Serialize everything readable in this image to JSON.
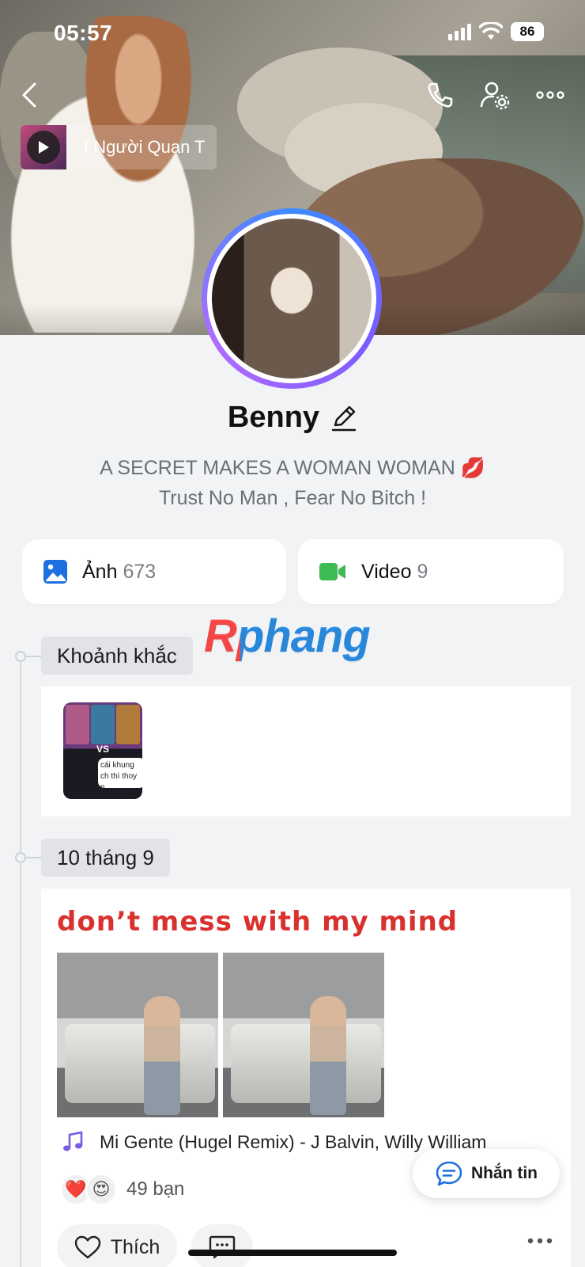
{
  "status_bar": {
    "time": "05:57",
    "battery": "86"
  },
  "cover": {
    "music": {
      "title_fragment": "t Người Quan T"
    }
  },
  "profile": {
    "name": "Benny",
    "bio_line1": "A SECRET MAKES A WOMAN WOMAN 💋",
    "bio_line2": "Trust No Man , Fear No Bitch !"
  },
  "media": {
    "photos": {
      "label": "Ảnh",
      "count": "673"
    },
    "videos": {
      "label": "Video",
      "count": "9"
    }
  },
  "watermark": "Rphang",
  "timeline": {
    "moments_label": "Khoảnh khắc",
    "moment_thumb": {
      "vs": "VS",
      "bubble_text": "cái khung ch thì thoy n"
    },
    "date_label": "10 tháng 9",
    "post": {
      "title": "don’t mess with my mind",
      "song": "Mi Gente (Hugel Remix) - J Balvin, Willy William",
      "reaction_count": "49 bạn",
      "reaction_emojis": [
        "❤️",
        "😍"
      ],
      "like_label": "Thích"
    }
  },
  "fab": {
    "label": "Nhắn tin"
  },
  "colors": {
    "accent_blue": "#2c8fe6",
    "video_green": "#3cba54",
    "post_title_red": "#d9322e",
    "avatar_ring_start": "#3d8bff",
    "avatar_ring_end": "#b06cff"
  }
}
